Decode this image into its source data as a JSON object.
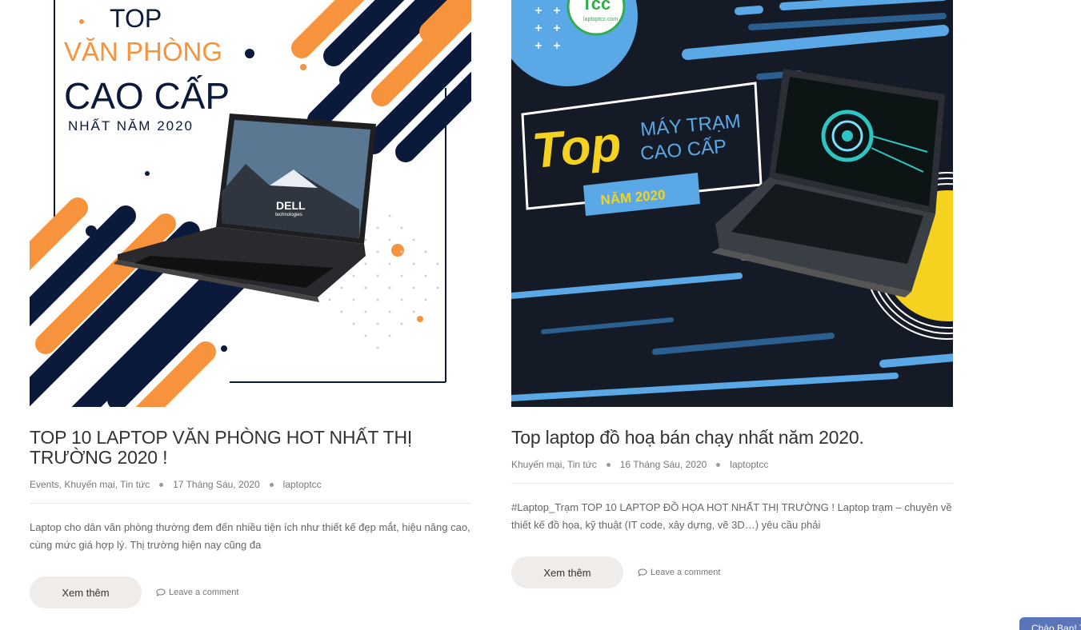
{
  "posts": [
    {
      "image": {
        "top_label": "TOP",
        "line_2": "VĂN PHÒNG",
        "line_3": "CAO CẤP",
        "line_4": "NHẤT NĂM 2020",
        "laptop_logo": "DELL",
        "laptop_sub": "technologies"
      },
      "title": "TOP 10 LAPTOP VĂN PHÒNG HOT NHẤT THỊ TRƯỜNG 2020 !",
      "categories": "Events, Khuyến mại, Tin tức",
      "date": "17 Tháng Sáu, 2020",
      "author": "laptoptcc",
      "excerpt": "Laptop cho dân văn phòng thường đem đến nhiều tiện ích như thiết kế đẹp mắt, hiệu năng cao, cùng mức giá hợp lý. Thị trường hiện nay cũng đa",
      "read_more": "Xem thêm",
      "comment": "Leave a comment"
    },
    {
      "image": {
        "logo_text": "Tcc",
        "logo_sub": "laptoptcc.com",
        "big_word": "Top",
        "line_2": "MÁY TRẠM",
        "line_3": "CAO CẤP",
        "year_badge": "NĂM 2020"
      },
      "title": "Top laptop đồ hoạ bán chạy nhất năm 2020.",
      "categories": "Khuyến mại, Tin tức",
      "date": "16 Tháng Sáu, 2020",
      "author": "laptoptcc",
      "excerpt": "#Laptop_Trạm TOP 10 LAPTOP ĐỒ HỌA HOT NHẤT THỊ TRƯỜNG ! Laptop trạm – chuyên về thiết kế đồ họa, kỹ thuật (IT code, xây dựng, vẽ 3D…) yêu cầu phải",
      "read_more": "Xem thêm",
      "comment": "Leave a comment"
    }
  ],
  "chat": {
    "label": "Chào Bạn! T"
  },
  "colors": {
    "navy": "#0b1a3a",
    "orange": "#f7923d",
    "dark_bg": "#141a26",
    "light_blue": "#5aa9e6",
    "yellow": "#f4d21f",
    "button_bg": "#f0ecea"
  },
  "icons": {
    "comment": "speech-bubble-icon"
  }
}
